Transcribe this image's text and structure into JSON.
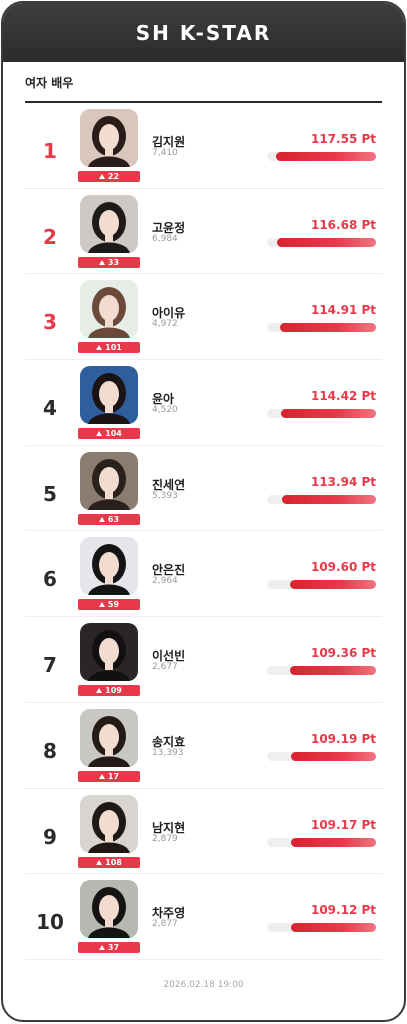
{
  "header": {
    "title": "SH K-STAR"
  },
  "category": {
    "label": "여자 배우"
  },
  "colors": {
    "accent": "#e8394a",
    "header_bg": "#333333"
  },
  "list": [
    {
      "rank": "1",
      "name": "김지원",
      "votes": "7,410",
      "change": "22",
      "score": "117.55 Pt",
      "score_value": 117.55,
      "top": true,
      "tone": "#d9c6bd",
      "hair": "#2a1c18"
    },
    {
      "rank": "2",
      "name": "고윤정",
      "votes": "6,984",
      "change": "33",
      "score": "116.68 Pt",
      "score_value": 116.68,
      "top": true,
      "tone": "#cfc9c6",
      "hair": "#1e1a19"
    },
    {
      "rank": "3",
      "name": "아이유",
      "votes": "4,972",
      "change": "101",
      "score": "114.91 Pt",
      "score_value": 114.91,
      "top": true,
      "tone": "#e6ece6",
      "hair": "#6b4a3a"
    },
    {
      "rank": "4",
      "name": "윤아",
      "votes": "4,520",
      "change": "104",
      "score": "114.42 Pt",
      "score_value": 114.42,
      "top": false,
      "tone": "#2e5f9c",
      "hair": "#1c1414"
    },
    {
      "rank": "5",
      "name": "진세연",
      "votes": "5,393",
      "change": "63",
      "score": "113.94 Pt",
      "score_value": 113.94,
      "top": false,
      "tone": "#8b7c70",
      "hair": "#2a211d"
    },
    {
      "rank": "6",
      "name": "안은진",
      "votes": "2,964",
      "change": "59",
      "score": "109.60 Pt",
      "score_value": 109.6,
      "top": false,
      "tone": "#e4e6ec",
      "hair": "#151313"
    },
    {
      "rank": "7",
      "name": "이선빈",
      "votes": "2,677",
      "change": "109",
      "score": "109.36 Pt",
      "score_value": 109.36,
      "top": false,
      "tone": "#2a2625",
      "hair": "#121010"
    },
    {
      "rank": "8",
      "name": "송지효",
      "votes": "13,393",
      "change": "17",
      "score": "109.19 Pt",
      "score_value": 109.19,
      "top": false,
      "tone": "#c8c7c4",
      "hair": "#241b17"
    },
    {
      "rank": "9",
      "name": "남지현",
      "votes": "2,879",
      "change": "108",
      "score": "109.17 Pt",
      "score_value": 109.17,
      "top": false,
      "tone": "#d8d4cf",
      "hair": "#1f1815"
    },
    {
      "rank": "10",
      "name": "차주영",
      "votes": "2,877",
      "change": "37",
      "score": "109.12 Pt",
      "score_value": 109.12,
      "top": false,
      "tone": "#b9b7b4",
      "hair": "#161313"
    }
  ],
  "footer": {
    "timestamp": "2026.02.18 19:00"
  }
}
